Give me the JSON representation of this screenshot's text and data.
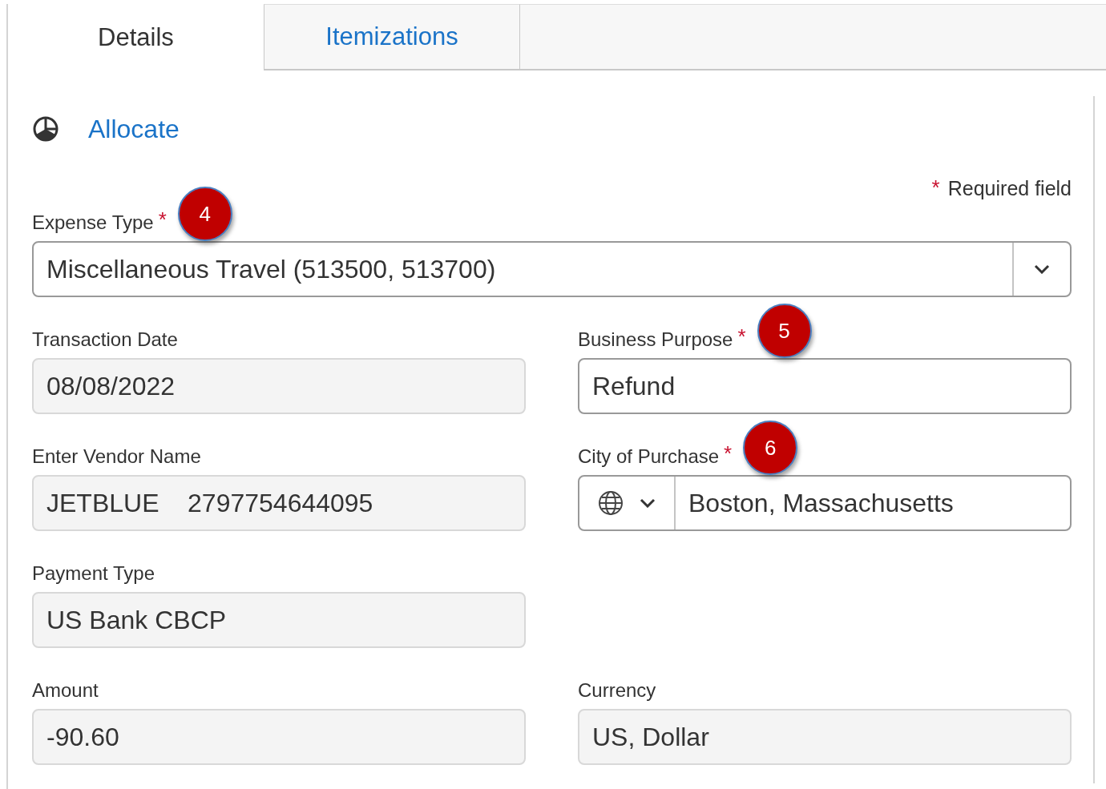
{
  "tabs": [
    {
      "label": "Details",
      "selected": true
    },
    {
      "label": "Itemizations",
      "selected": false
    }
  ],
  "allocate": {
    "label": "Allocate"
  },
  "required_note": {
    "mark": "*",
    "text": "Required field"
  },
  "rows": [
    {
      "fields": [
        {
          "label": "Expense Type",
          "required": true,
          "callout": "4",
          "kind": "select",
          "value": "Miscellaneous Travel (513500, 513700)",
          "wide": true
        }
      ]
    },
    {
      "fields": [
        {
          "label": "Transaction Date",
          "required": false,
          "kind": "readonly",
          "value": "08/08/2022"
        },
        {
          "label": "Business Purpose",
          "required": true,
          "callout": "5",
          "kind": "text",
          "value": "Refund"
        }
      ]
    },
    {
      "fields": [
        {
          "label": "Enter Vendor Name",
          "required": false,
          "kind": "readonly",
          "value": "JETBLUE    2797754644095"
        },
        {
          "label": "City of Purchase",
          "required": true,
          "callout": "6",
          "kind": "city",
          "value": "Boston, Massachusetts"
        }
      ]
    },
    {
      "fields": [
        {
          "label": "Payment Type",
          "required": false,
          "kind": "readonly",
          "value": "US Bank CBCP"
        }
      ]
    },
    {
      "fields": [
        {
          "label": "Amount",
          "required": false,
          "kind": "readonly",
          "value": "-90.60"
        },
        {
          "label": "Currency",
          "required": false,
          "kind": "readonly",
          "value": "US, Dollar"
        }
      ]
    }
  ]
}
